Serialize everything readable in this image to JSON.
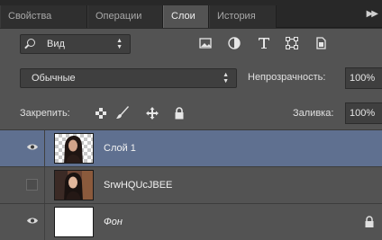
{
  "tabs": [
    {
      "label": "Свойства"
    },
    {
      "label": "Операции"
    },
    {
      "label": "Слои"
    },
    {
      "label": "История"
    }
  ],
  "active_tab": "Слои",
  "tab_menu_icon": "panel-menu-icon",
  "filter": {
    "kind_label": "Вид",
    "icons": [
      "image-filter-icon",
      "adjustment-filter-icon",
      "type-filter-icon",
      "shape-filter-icon",
      "smart-object-filter-icon"
    ]
  },
  "blend": {
    "mode": "Обычные",
    "opacity_label": "Непрозрачность:",
    "opacity_value": "100%"
  },
  "lock": {
    "label": "Закрепить:",
    "icons": [
      "lock-transparent-icon",
      "lock-image-icon",
      "lock-position-icon",
      "lock-all-icon"
    ],
    "fill_label": "Заливка:",
    "fill_value": "100%"
  },
  "layers": [
    {
      "name": "Слой 1",
      "visible": true,
      "selected": true,
      "thumb": "portrait-on-transparent",
      "locked": false
    },
    {
      "name": "SrwHQUcJBEE",
      "visible": false,
      "selected": false,
      "thumb": "photo",
      "locked": false
    },
    {
      "name": "Фон",
      "visible": true,
      "selected": false,
      "thumb": "white",
      "locked": true
    }
  ],
  "colors": {
    "panel": "#535353",
    "selected_row": "#5f7090",
    "tab_active": "#535353"
  }
}
